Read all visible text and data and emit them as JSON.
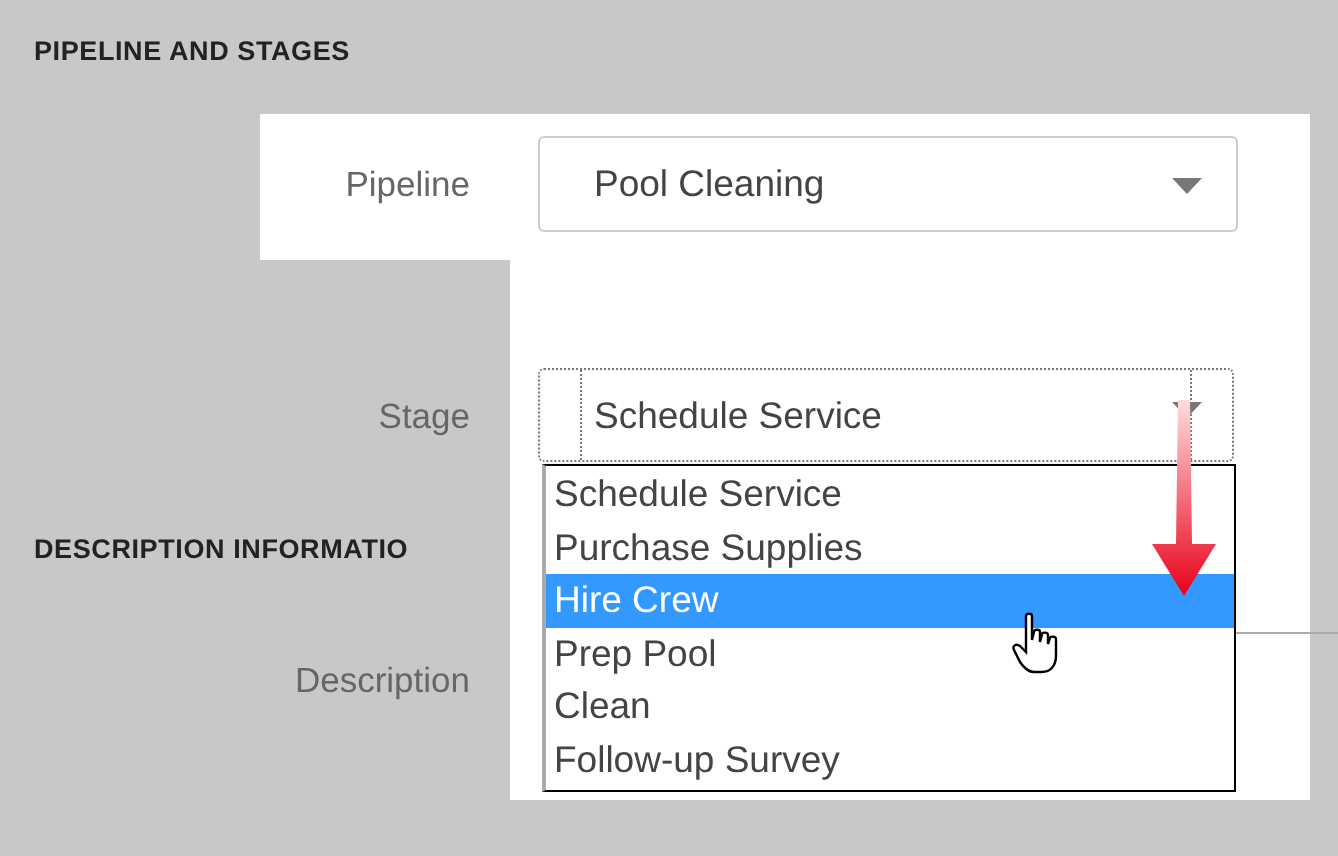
{
  "section_1": {
    "title": "PIPELINE AND STAGES"
  },
  "pipeline": {
    "label": "Pipeline",
    "value": "Pool Cleaning"
  },
  "stage": {
    "label": "Stage",
    "value": "Schedule Service",
    "expanded": true,
    "options": [
      {
        "label": "Schedule Service",
        "highlighted": false
      },
      {
        "label": "Purchase Supplies",
        "highlighted": false
      },
      {
        "label": "Hire Crew",
        "highlighted": true
      },
      {
        "label": "Prep Pool",
        "highlighted": false
      },
      {
        "label": "Clean",
        "highlighted": false
      },
      {
        "label": "Follow-up Survey",
        "highlighted": false
      }
    ]
  },
  "section_2": {
    "title": "DESCRIPTION INFORMATIO"
  },
  "description": {
    "label": "Description"
  }
}
